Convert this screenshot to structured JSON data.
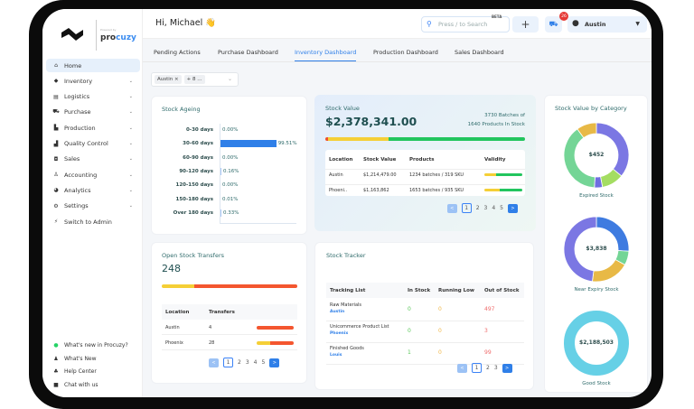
{
  "brand": {
    "powered_by": "Powered by",
    "name_a": "pro",
    "name_b": "cuzy"
  },
  "sidebar": {
    "items": [
      {
        "label": "Home",
        "icon": "home-icon",
        "glyph": "⌂",
        "active": true,
        "chev": false
      },
      {
        "label": "Inventory",
        "icon": "tag-icon",
        "glyph": "◆",
        "chev": true
      },
      {
        "label": "Logistics",
        "icon": "truck-icon",
        "glyph": "▤",
        "chev": true
      },
      {
        "label": "Purchase",
        "icon": "cart-icon",
        "glyph": "⛟",
        "chev": true
      },
      {
        "label": "Production",
        "icon": "factory-icon",
        "glyph": "▙",
        "chev": true
      },
      {
        "label": "Quality Control",
        "icon": "building-icon",
        "glyph": "▟",
        "chev": true
      },
      {
        "label": "Sales",
        "icon": "bag-icon",
        "glyph": "◘",
        "chev": true
      },
      {
        "label": "Accounting",
        "icon": "money-icon",
        "glyph": "♙",
        "chev": true
      },
      {
        "label": "Analytics",
        "icon": "pie-chart-icon",
        "glyph": "◕",
        "chev": true
      },
      {
        "label": "Settings",
        "icon": "gear-icon",
        "glyph": "⚙",
        "chev": true
      },
      {
        "label": "Switch to Admin",
        "icon": "bolt-icon",
        "glyph": "⚡",
        "chev": false
      }
    ],
    "footer": [
      {
        "label": "What's new in Procuzy?",
        "icon": "whatsapp-icon",
        "glyph": "●"
      },
      {
        "label": "What's New",
        "icon": "bell-icon",
        "glyph": "♟"
      },
      {
        "label": "Help Center",
        "icon": "thumbs-up-icon",
        "glyph": "♣"
      },
      {
        "label": "Chat with us",
        "icon": "chat-icon",
        "glyph": "■"
      }
    ]
  },
  "header": {
    "greeting": "Hi, Michael 👋",
    "search_placeholder": "Press / to Search",
    "beta": "BETA",
    "cart_count": "26",
    "user": "Austin"
  },
  "tabs": [
    "Pending Actions",
    "Purchase Dashboard",
    "Inventory Dashboard",
    "Production Dashboard",
    "Sales Dashboard"
  ],
  "active_tab": 2,
  "filter": {
    "chips": [
      "Austin ×",
      "+ 8 ..."
    ]
  },
  "stock_ageing": {
    "title": "Stock Ageing",
    "rows": [
      {
        "label": "0-30 days",
        "value": "0.00%",
        "pct": 0
      },
      {
        "label": "30-60 days",
        "value": "99.51%",
        "pct": 99.51
      },
      {
        "label": "60-90 days",
        "value": "0.00%",
        "pct": 0
      },
      {
        "label": "90-120 days",
        "value": "0.16%",
        "pct": 0.16
      },
      {
        "label": "120-150 days",
        "value": "0.00%",
        "pct": 0
      },
      {
        "label": "150-180 days",
        "value": "0.01%",
        "pct": 0.01
      },
      {
        "label": "Over 180 days",
        "value": "0.33%",
        "pct": 0.33
      }
    ]
  },
  "stock_value": {
    "title": "Stock Value",
    "amount": "$2,378,341.00",
    "batches_line1": "3730 Batches of",
    "batches_line2": "1640 Products In Stock",
    "bar": [
      {
        "color": "#f0502e",
        "pct": 1.5
      },
      {
        "color": "#f5cf36",
        "pct": 30
      },
      {
        "color": "#22c55e",
        "pct": 68.5
      }
    ],
    "headers": [
      "Location",
      "Stock Value",
      "Products",
      "Validity"
    ],
    "rows": [
      {
        "location": "Austin",
        "value": "$1,214,479.00",
        "products": "1234 batches / 319 SKU",
        "validity": [
          30,
          70
        ]
      },
      {
        "location": "Phoeni..",
        "value": "$1,163,862",
        "products": "1653 batches / 935 SKU",
        "validity": [
          40,
          60
        ]
      }
    ],
    "pages": [
      "1",
      "2",
      "3",
      "4",
      "5"
    ]
  },
  "category": {
    "title": "Stock Value by Category",
    "charts": [
      {
        "label": "Expired Stock",
        "center": "$452",
        "segments": [
          {
            "v": 36,
            "c": "#7b77e3"
          },
          {
            "v": 11,
            "c": "#a4dd62"
          },
          {
            "v": 4,
            "c": "#6f6fe0"
          },
          {
            "v": 39,
            "c": "#74d596"
          },
          {
            "v": 10,
            "c": "#e8b946"
          }
        ]
      },
      {
        "label": "Near Expiry Stock",
        "center": "$3,838",
        "segments": [
          {
            "v": 26,
            "c": "#3e7be0"
          },
          {
            "v": 7,
            "c": "#74d596"
          },
          {
            "v": 19,
            "c": "#e8b946"
          },
          {
            "v": 48,
            "c": "#7b77e3"
          }
        ]
      },
      {
        "label": "Good Stock",
        "center": "$2,188,503",
        "segments": [
          {
            "v": 100,
            "c": "#66d0e6"
          }
        ]
      }
    ]
  },
  "transfers": {
    "title": "Open Stock Transfers",
    "count": "248",
    "bar": [
      {
        "color": "#f5cf36",
        "pct": 24
      },
      {
        "color": "#f4562f",
        "pct": 76
      }
    ],
    "headers": [
      "Location",
      "Transfers"
    ],
    "rows": [
      {
        "location": "Austin",
        "transfers": "4",
        "bar": [
          0,
          100
        ]
      },
      {
        "location": "Phoenix",
        "transfers": "28",
        "bar": [
          36,
          64
        ]
      }
    ],
    "pages": [
      "1",
      "2",
      "3",
      "4",
      "5"
    ]
  },
  "tracker": {
    "title": "Stock Tracker",
    "headers": [
      "Tracking List",
      "In Stock",
      "Running Low",
      "Out of Stock"
    ],
    "rows": [
      {
        "name": "Raw Materials",
        "loc": "Austin",
        "in": "0",
        "low": "0",
        "out": "497"
      },
      {
        "name": "Unicommerce Product List",
        "loc": "Phoenix",
        "in": "0",
        "low": "0",
        "out": "3"
      },
      {
        "name": "Finished Goods",
        "loc": "Louis",
        "in": "1",
        "low": "0",
        "out": "99"
      }
    ],
    "pages": [
      "1",
      "2",
      "3"
    ]
  },
  "colors": {
    "accent": "#2f7fe8",
    "in_stock": "#5cc85c",
    "running_low": "#f0b84a",
    "out_of_stock": "#ef6b6b"
  }
}
